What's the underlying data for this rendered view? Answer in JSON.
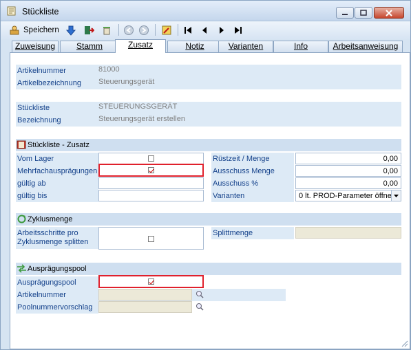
{
  "window": {
    "title": "Stückliste"
  },
  "toolbar": {
    "save_label": "Speichern"
  },
  "tabs": [
    {
      "label": "Zuweisung"
    },
    {
      "label": "Stamm"
    },
    {
      "label": "Zusatz"
    },
    {
      "label": "Notiz"
    },
    {
      "label": "Varianten"
    },
    {
      "label": "Info"
    },
    {
      "label": "Arbeitsanweisung"
    }
  ],
  "article": {
    "number_label": "Artikelnummer",
    "number_value": "81000",
    "name_label": "Artikelbezeichnung",
    "name_value": "Steuerungsgerät"
  },
  "bom": {
    "label": "Stückliste",
    "value": "STEUERUNGSGERÄT",
    "desc_label": "Bezeichnung",
    "desc_value": "Steuerungsgerät erstellen"
  },
  "zusatz": {
    "section_title": "Stückliste - Zusatz",
    "vom_lager": "Vom Lager",
    "vom_lager_checked": false,
    "mehrfach": "Mehrfachausprägungen",
    "mehrfach_checked": true,
    "gueltig_ab": "gültig ab",
    "gueltig_ab_value": "",
    "gueltig_bis": "gültig bis",
    "gueltig_bis_value": "",
    "ruestzeit": "Rüstzeit / Menge",
    "ruestzeit_value": "0,00",
    "ausschuss_menge": "Ausschuss Menge",
    "ausschuss_menge_value": "0,00",
    "ausschuss_pct": "Ausschuss %",
    "ausschuss_pct_value": "0,00",
    "varianten": "Varianten",
    "varianten_value": "0 lt. PROD-Parameter öffne"
  },
  "zyklus": {
    "section_title": "Zyklusmenge",
    "split_label_1": "Arbeitsschritte pro",
    "split_label_2": "Zyklusmenge splitten",
    "split_checked": false,
    "splittmenge": "Splittmenge"
  },
  "pool": {
    "section_title": "Ausprägungspool",
    "pool_label": "Ausprägungspool",
    "pool_checked": true,
    "artikelnummer": "Artikelnummer",
    "poolnummer": "Poolnummervorschlag"
  },
  "colors": {
    "accent": "#15428b",
    "highlight": "#e0202c",
    "section": "#cfdff0"
  }
}
